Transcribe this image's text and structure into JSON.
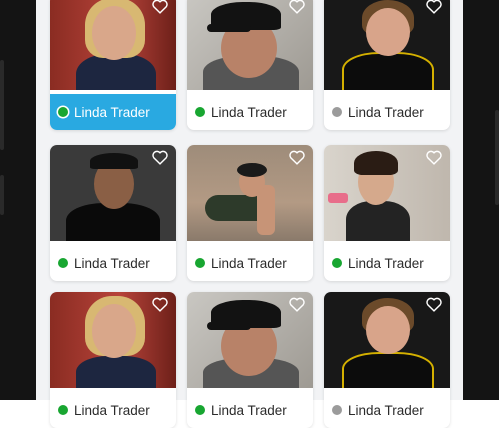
{
  "cards": [
    {
      "name": "Linda Trader",
      "status": "online",
      "selected": true,
      "photo": "portrait-blonde-woman-red-background"
    },
    {
      "name": "Linda Trader",
      "status": "online",
      "selected": false,
      "photo": "portrait-man-black-ny-cap"
    },
    {
      "name": "Linda Trader",
      "status": "offline",
      "selected": false,
      "photo": "portrait-woman-black-jacket"
    },
    {
      "name": "Linda Trader",
      "status": "online",
      "selected": false,
      "photo": "portrait-man-black-cap-tank-top"
    },
    {
      "name": "Linda Trader",
      "status": "online",
      "selected": false,
      "photo": "woman-doing-push-up"
    },
    {
      "name": "Linda Trader",
      "status": "online",
      "selected": false,
      "photo": "woman-lifting-dumbbells"
    },
    {
      "name": "Linda Trader",
      "status": "online",
      "selected": false,
      "photo": "portrait-blonde-woman-red-background"
    },
    {
      "name": "Linda Trader",
      "status": "online",
      "selected": false,
      "photo": "portrait-man-black-ny-cap"
    },
    {
      "name": "Linda Trader",
      "status": "offline",
      "selected": false,
      "photo": "portrait-woman-black-jacket"
    }
  ],
  "colors": {
    "accent": "#29a9e1",
    "online": "#18a631",
    "offline": "#9b9b9b"
  },
  "icons": {
    "favorite": "heart-outline-icon"
  }
}
